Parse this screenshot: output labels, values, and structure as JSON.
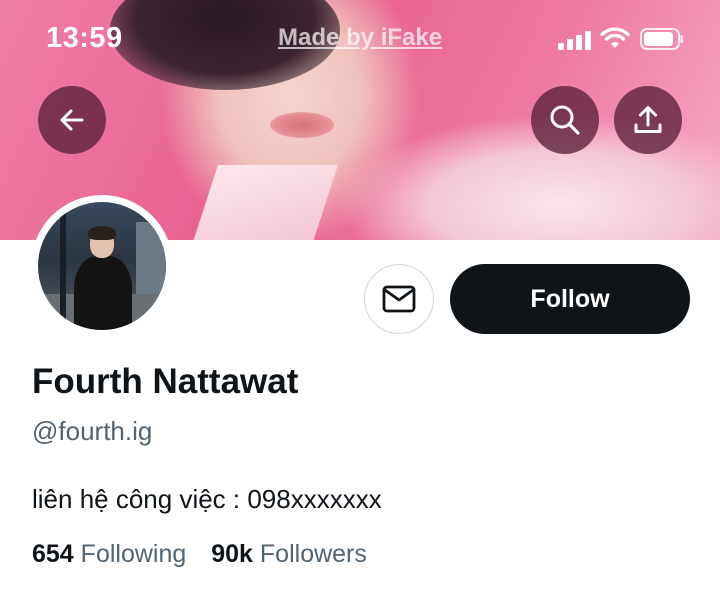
{
  "status_bar": {
    "time": "13:59",
    "watermark": "Made by iFake"
  },
  "header": {
    "back_icon": "arrow-left-icon",
    "search_icon": "search-icon",
    "share_icon": "share-upload-icon"
  },
  "actions": {
    "message_icon": "envelope-icon",
    "follow_label": "Follow"
  },
  "profile": {
    "display_name": "Fourth Nattawat",
    "handle": "@fourth.ig",
    "bio": "liên hệ công việc : 098xxxxxxx",
    "following_count": "654",
    "following_label": "Following",
    "followers_count": "90k",
    "followers_label": "Followers"
  },
  "colors": {
    "banner_pink": "#e85f90",
    "follow_bg": "#0f1419",
    "secondary_text": "#536471",
    "header_button_bg": "#5a203a"
  }
}
